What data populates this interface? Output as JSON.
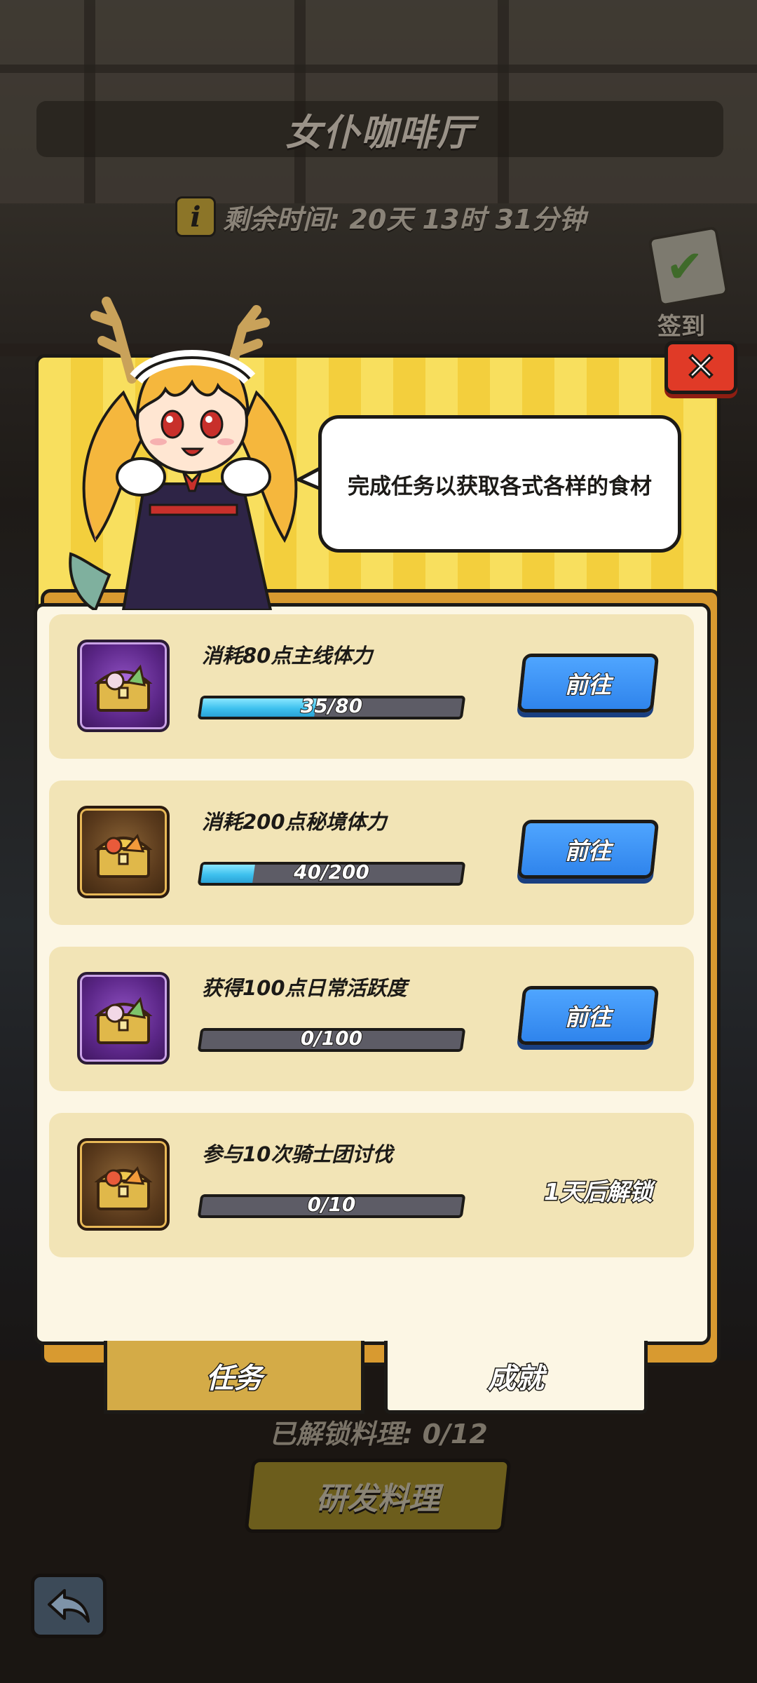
{
  "header": {
    "title": "女仆咖啡厅",
    "timer_text": "剩余时间: 20天 13时 31分钟",
    "info_icon_glyph": "i"
  },
  "signin": {
    "label": "签到",
    "icon": "calendar-check-icon"
  },
  "modal": {
    "close_glyph": "✕",
    "speech": "完成任务以获取各式各样的食材",
    "tasks": [
      {
        "title": "消耗80点主线体力",
        "progress_text": "35/80",
        "current": 35,
        "total": 80,
        "chest": "purple",
        "action": "前往"
      },
      {
        "title": "消耗200点秘境体力",
        "progress_text": "40/200",
        "current": 40,
        "total": 200,
        "chest": "gold",
        "action": "前往"
      },
      {
        "title": "获得100点日常活跃度",
        "progress_text": "0/100",
        "current": 0,
        "total": 100,
        "chest": "purple",
        "action": "前往"
      },
      {
        "title": "参与10次骑士团讨伐",
        "progress_text": "0/10",
        "current": 0,
        "total": 10,
        "chest": "gold",
        "locked_text": "1天后解锁"
      }
    ],
    "tabs": {
      "tasks": "任务",
      "achievements": "成就"
    }
  },
  "footer": {
    "unlock_count": "已解锁料理: 0/12",
    "research_button": "研发料理"
  },
  "colors": {
    "accent_blue": "#2f84ec",
    "close_red": "#e03a27",
    "panel_yellow": "#f8df5e",
    "card_bg": "#f2e4b6"
  }
}
